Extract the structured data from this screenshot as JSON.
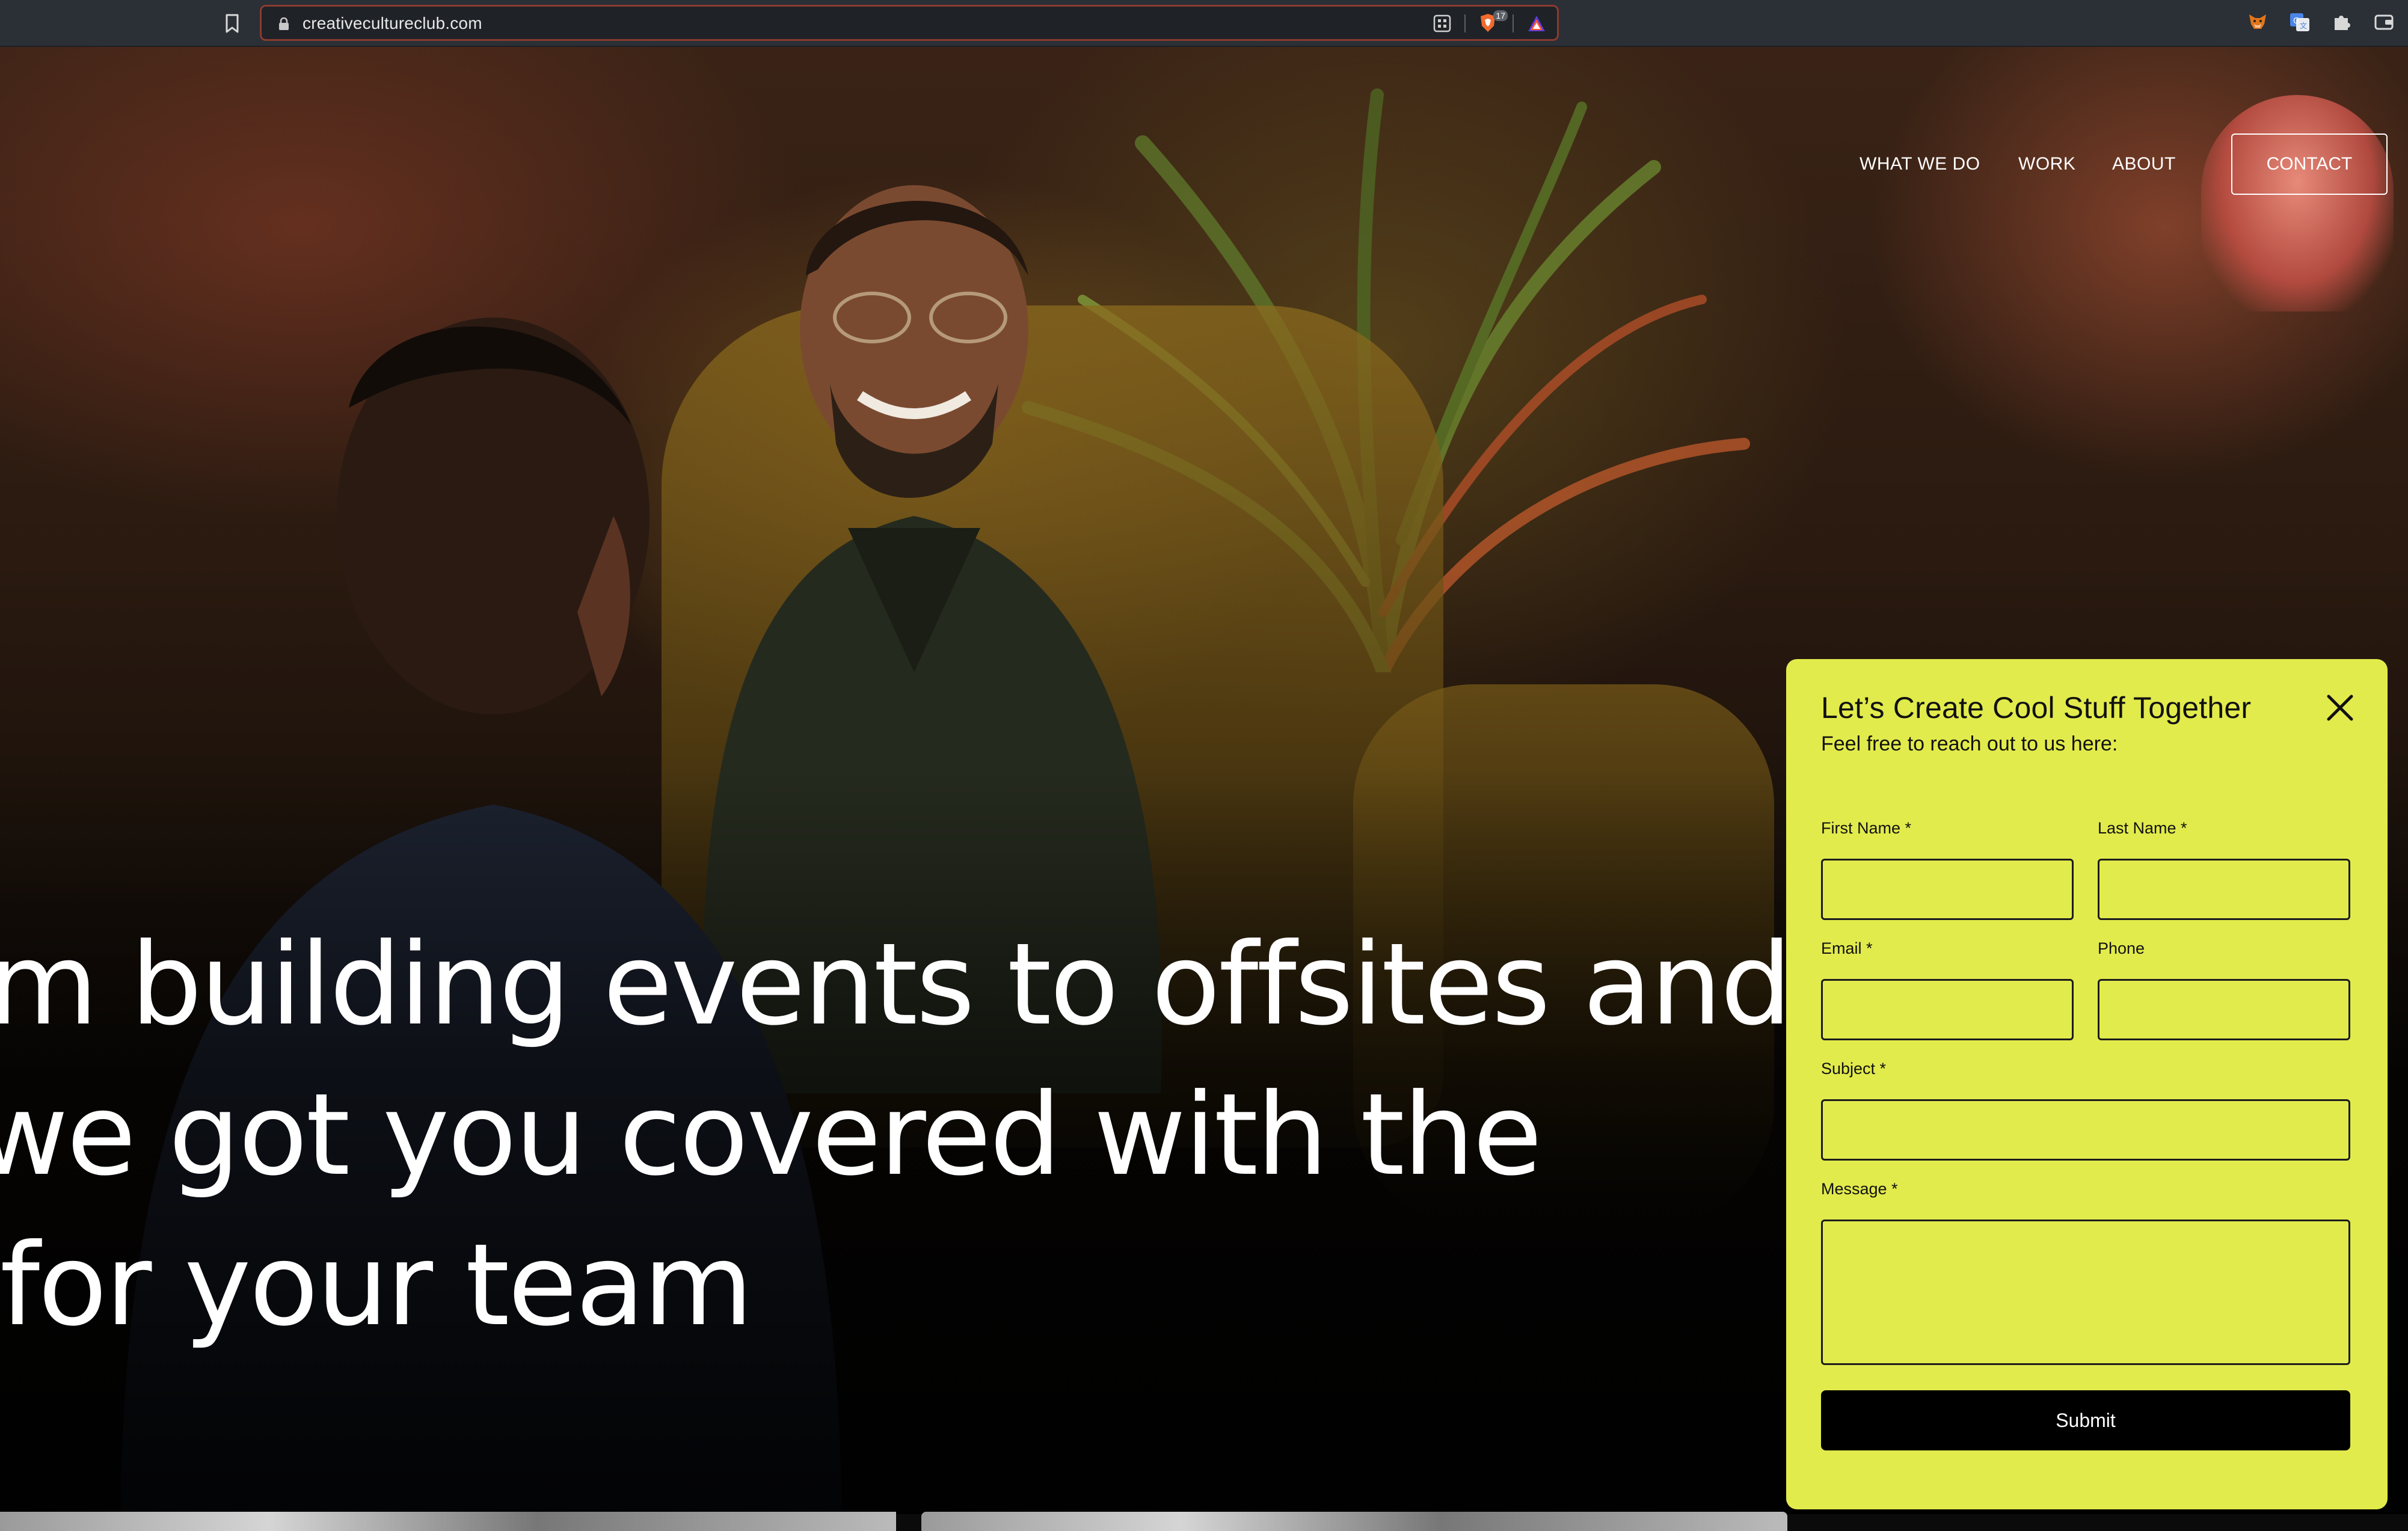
{
  "browser": {
    "url": "creativecultureclub.com",
    "shield_count": "17"
  },
  "nav": {
    "what_we_do": "WHAT WE DO",
    "work": "WORK",
    "about": "ABOUT",
    "contact": "CONTACT"
  },
  "hero": {
    "line1": "m building events to offsites and",
    "line2": "we got you covered with the",
    "line3": "for your team"
  },
  "contact_form": {
    "title": "Let’s Create Cool Stuff Together",
    "subtitle": "Feel free to reach out to us here:",
    "first_name_label": "First Name *",
    "last_name_label": "Last Name *",
    "email_label": "Email *",
    "phone_label": "Phone",
    "subject_label": "Subject *",
    "message_label": "Message *",
    "first_name_value": "",
    "last_name_value": "",
    "email_value": "",
    "phone_value": "",
    "subject_value": "",
    "message_value": "",
    "submit_label": "Submit"
  },
  "colors": {
    "modal_bg": "#e2eb4c",
    "submit_bg": "#000000",
    "chrome_bg": "#2b2f36",
    "urlbar_border": "#8a3b2f"
  },
  "icons": {
    "bookmark": "bookmark-icon",
    "lock": "lock-icon",
    "qr": "qr-code-icon",
    "shield": "brave-shield-icon",
    "rewards": "brave-rewards-icon",
    "fox": "metamask-fox-icon",
    "translate": "translate-icon",
    "puzzle": "extensions-puzzle-icon",
    "wallet": "wallet-icon",
    "close": "close-icon"
  }
}
